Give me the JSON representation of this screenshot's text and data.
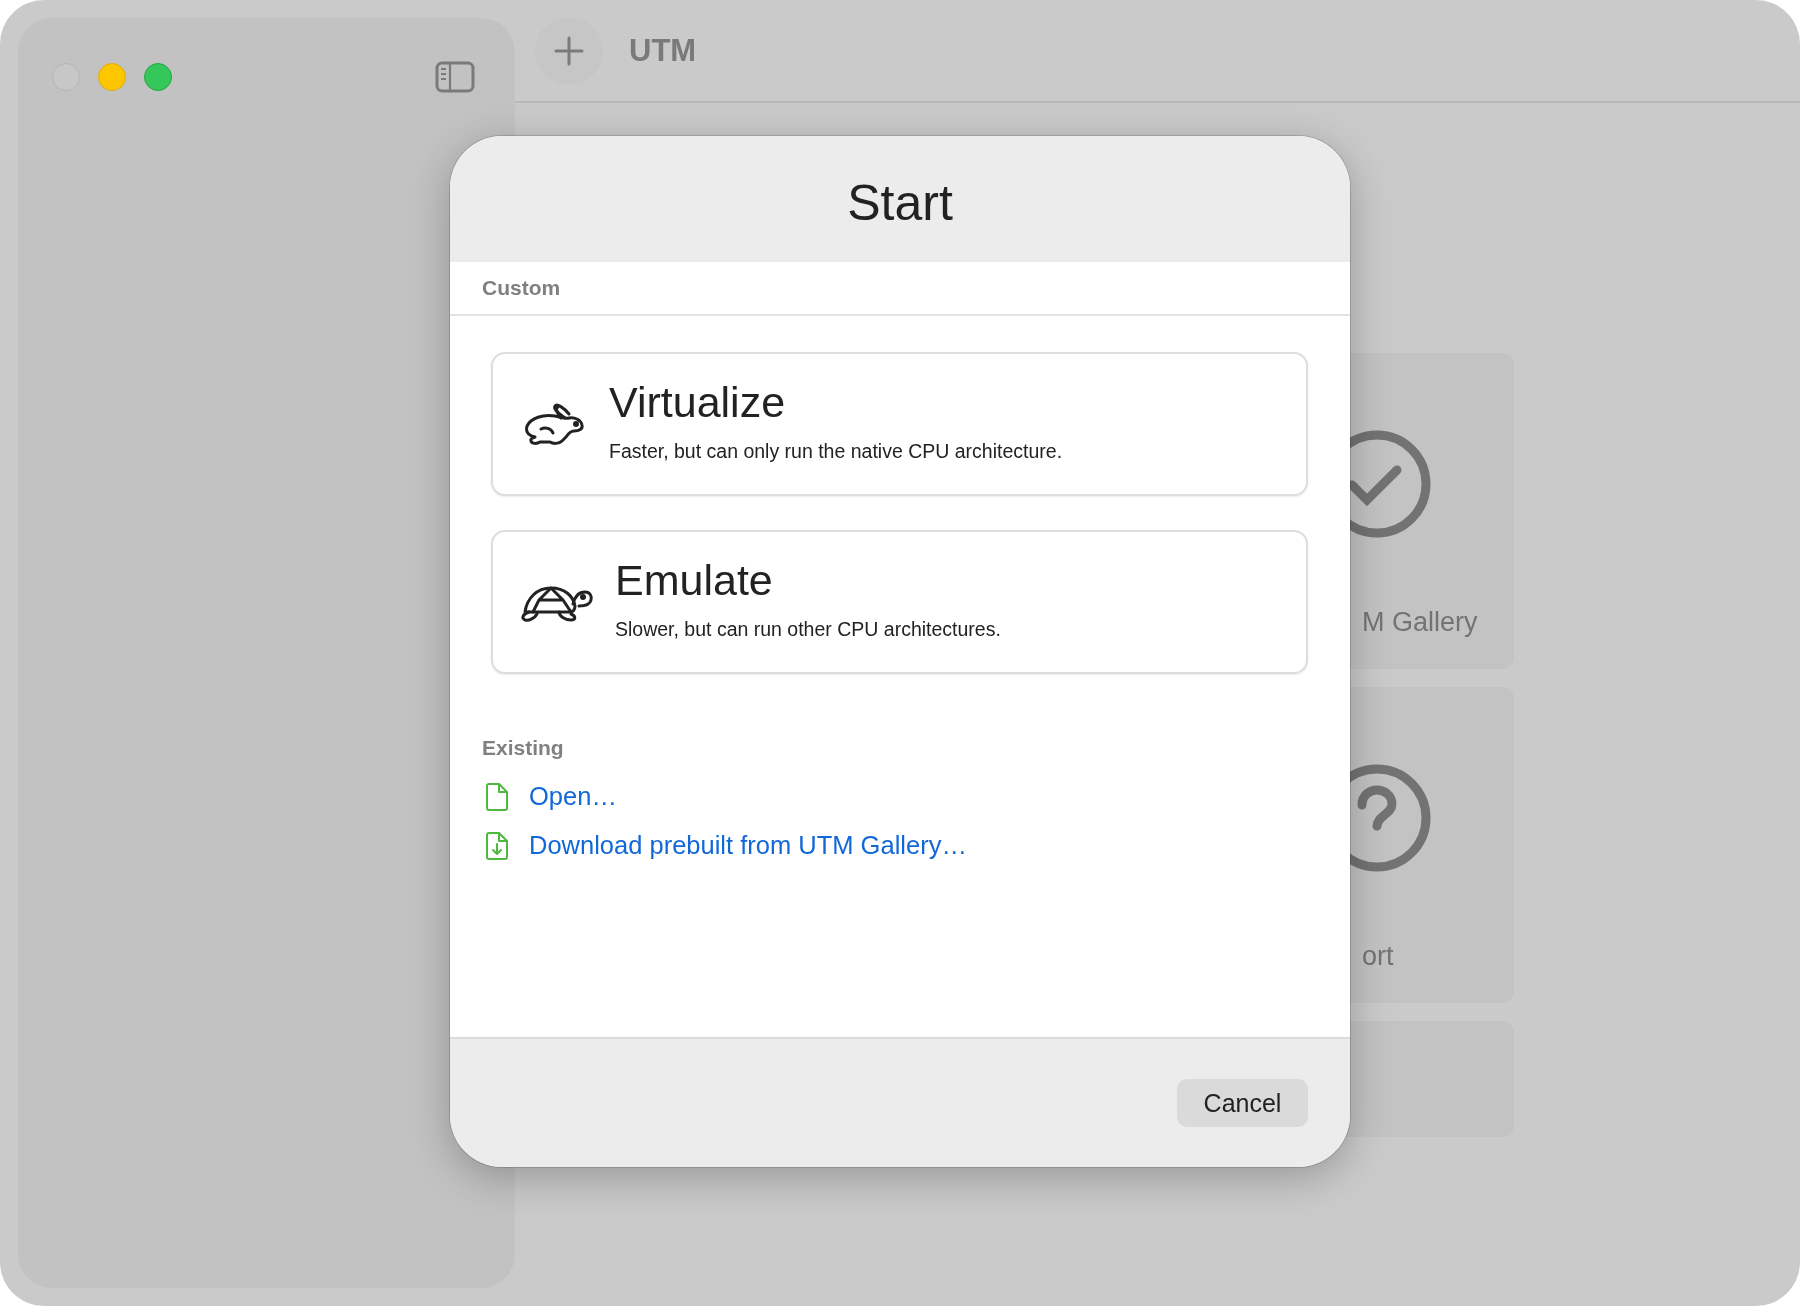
{
  "window": {
    "title": "UTM",
    "close_enabled": false
  },
  "background_cards": [
    {
      "label": "M Gallery",
      "kind": "check"
    },
    {
      "label": "ort",
      "kind": "help"
    }
  ],
  "dialog": {
    "title": "Start",
    "custom_heading": "Custom",
    "options": [
      {
        "kind": "rabbit",
        "title": "Virtualize",
        "description": "Faster, but can only run the native CPU architecture."
      },
      {
        "kind": "turtle",
        "title": "Emulate",
        "description": "Slower, but can run other CPU architectures."
      }
    ],
    "existing_heading": "Existing",
    "links": [
      {
        "kind": "file",
        "label": "Open…"
      },
      {
        "kind": "download",
        "label": "Download prebuilt from UTM Gallery…"
      }
    ],
    "buttons": [
      "Cancel"
    ]
  }
}
